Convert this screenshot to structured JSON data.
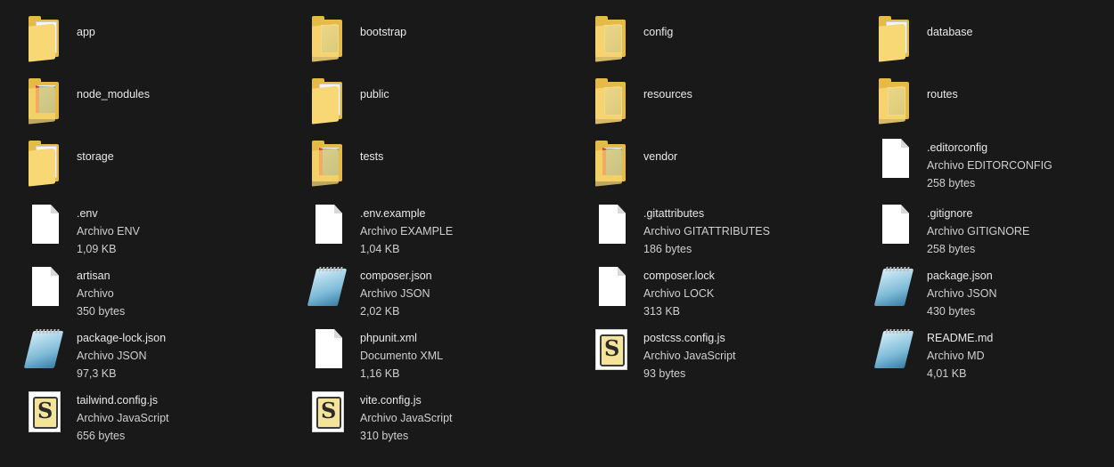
{
  "items": [
    {
      "name": "app",
      "type": "",
      "size": "",
      "icon": "folder-icon",
      "row": 0,
      "col": 0
    },
    {
      "name": "bootstrap",
      "type": "",
      "size": "",
      "icon": "folder-docs-icon",
      "row": 0,
      "col": 1
    },
    {
      "name": "config",
      "type": "",
      "size": "",
      "icon": "folder-docs-icon",
      "row": 0,
      "col": 2
    },
    {
      "name": "database",
      "type": "",
      "size": "",
      "icon": "folder-icon",
      "row": 0,
      "col": 3
    },
    {
      "name": "node_modules",
      "type": "",
      "size": "",
      "icon": "folder-red-doc-icon",
      "row": 1,
      "col": 0
    },
    {
      "name": "public",
      "type": "",
      "size": "",
      "icon": "folder-icon",
      "row": 1,
      "col": 1
    },
    {
      "name": "resources",
      "type": "",
      "size": "",
      "icon": "folder-docs-icon",
      "row": 1,
      "col": 2
    },
    {
      "name": "routes",
      "type": "",
      "size": "",
      "icon": "folder-docs-icon",
      "row": 1,
      "col": 3
    },
    {
      "name": "storage",
      "type": "",
      "size": "",
      "icon": "folder-icon",
      "row": 2,
      "col": 0
    },
    {
      "name": "tests",
      "type": "",
      "size": "",
      "icon": "folder-red-doc-icon",
      "row": 2,
      "col": 1
    },
    {
      "name": "vendor",
      "type": "",
      "size": "",
      "icon": "folder-red-doc-icon",
      "row": 2,
      "col": 2
    },
    {
      "name": ".editorconfig",
      "type": "Archivo EDITORCONFIG",
      "size": "258 bytes",
      "icon": "file-icon",
      "row": 2,
      "col": 3
    },
    {
      "name": ".env",
      "type": "Archivo ENV",
      "size": "1,09 KB",
      "icon": "file-icon",
      "row": 3,
      "col": 0
    },
    {
      "name": ".env.example",
      "type": "Archivo EXAMPLE",
      "size": "1,04 KB",
      "icon": "file-icon",
      "row": 3,
      "col": 1
    },
    {
      "name": ".gitattributes",
      "type": "Archivo GITATTRIBUTES",
      "size": "186 bytes",
      "icon": "file-icon",
      "row": 3,
      "col": 2
    },
    {
      "name": ".gitignore",
      "type": "Archivo GITIGNORE",
      "size": "258 bytes",
      "icon": "file-icon",
      "row": 3,
      "col": 3
    },
    {
      "name": "artisan",
      "type": "Archivo",
      "size": "350 bytes",
      "icon": "file-icon",
      "row": 4,
      "col": 0
    },
    {
      "name": "composer.json",
      "type": "Archivo JSON",
      "size": "2,02 KB",
      "icon": "json-notepad-icon",
      "row": 4,
      "col": 1
    },
    {
      "name": "composer.lock",
      "type": "Archivo LOCK",
      "size": "313 KB",
      "icon": "file-icon",
      "row": 4,
      "col": 2
    },
    {
      "name": "package.json",
      "type": "Archivo JSON",
      "size": "430 bytes",
      "icon": "json-notepad-icon",
      "row": 4,
      "col": 3
    },
    {
      "name": "package-lock.json",
      "type": "Archivo JSON",
      "size": "97,3 KB",
      "icon": "json-notepad-icon",
      "row": 5,
      "col": 0
    },
    {
      "name": "phpunit.xml",
      "type": "Documento XML",
      "size": "1,16 KB",
      "icon": "file-icon",
      "row": 5,
      "col": 1
    },
    {
      "name": "postcss.config.js",
      "type": "Archivo JavaScript",
      "size": "93 bytes",
      "icon": "js-script-icon",
      "row": 5,
      "col": 2
    },
    {
      "name": "README.md",
      "type": "Archivo MD",
      "size": "4,01 KB",
      "icon": "json-notepad-icon",
      "row": 5,
      "col": 3
    },
    {
      "name": "tailwind.config.js",
      "type": "Archivo JavaScript",
      "size": "656 bytes",
      "icon": "js-script-icon",
      "row": 6,
      "col": 0
    },
    {
      "name": "vite.config.js",
      "type": "Archivo JavaScript",
      "size": "310 bytes",
      "icon": "js-script-icon",
      "row": 6,
      "col": 1
    }
  ]
}
